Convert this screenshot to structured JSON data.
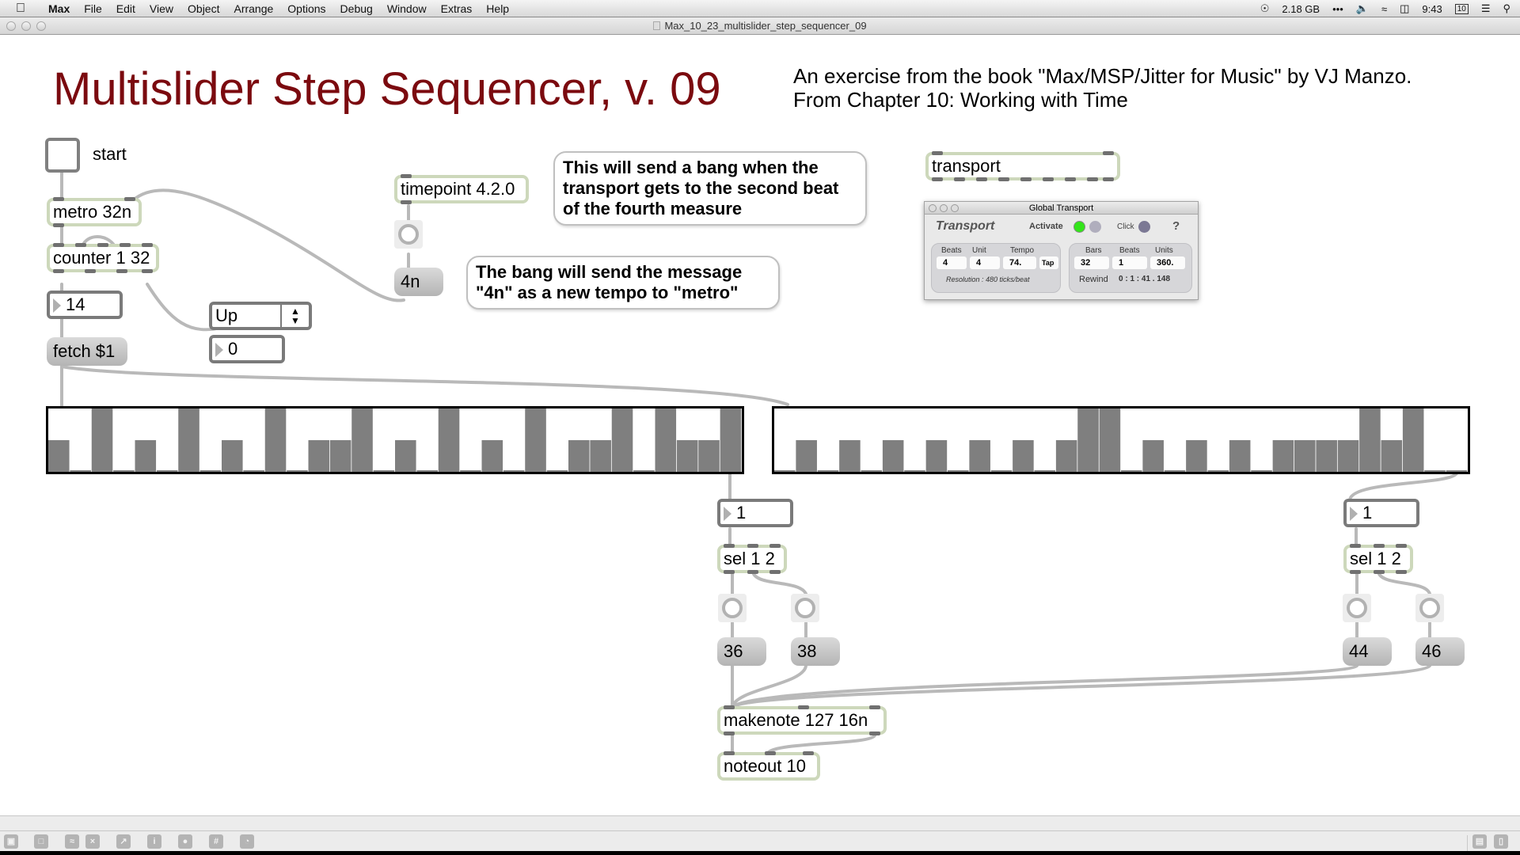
{
  "menubar": {
    "apple": "",
    "app": "Max",
    "items": [
      "File",
      "Edit",
      "View",
      "Object",
      "Arrange",
      "Options",
      "Debug",
      "Window",
      "Extras",
      "Help"
    ],
    "status": {
      "memory": "2.18 GB",
      "dots": "•••",
      "time": "9:43",
      "calendar": "10"
    }
  },
  "window": {
    "title": "Max_10_23_multislider_step_sequencer_09"
  },
  "patch": {
    "title": "Multislider Step Sequencer, v. 09",
    "subtitle_line1": "An exercise from the book \"Max/MSP/Jitter for Music\" by VJ Manzo.",
    "subtitle_line2": "From Chapter 10: Working with Time",
    "start_label": "start",
    "metro": "metro 32n",
    "counter": "counter 1 32",
    "counter_value": "14",
    "umenu_value": "Up",
    "direction_value": "0",
    "fetch": "fetch $1",
    "timepoint": "timepoint 4.2.0",
    "tempo_msg": "4n",
    "comment_timepoint": [
      "This will send a bang when the",
      "transport gets to the second beat",
      "of the fourth measure"
    ],
    "comment_msg": [
      "The bang will send the message",
      "\"4n\" as a new tempo to \"metro\""
    ],
    "transport": "transport",
    "left_number": "1",
    "right_number": "1",
    "left_sel": "sel 1 2",
    "right_sel": "sel 1 2",
    "note_36": "36",
    "note_38": "38",
    "note_44": "44",
    "note_46": "46",
    "makenote": "makenote 127 16n",
    "noteout": "noteout 10"
  },
  "multisliders": {
    "range": [
      0,
      2
    ],
    "left": [
      1,
      0,
      2,
      0,
      1,
      0,
      2,
      0,
      1,
      0,
      2,
      0,
      1,
      1,
      2,
      0,
      1,
      0,
      2,
      0,
      1,
      0,
      2,
      0,
      1,
      1,
      2,
      0,
      2,
      1,
      1,
      2
    ],
    "right": [
      0,
      1,
      0,
      1,
      0,
      1,
      0,
      1,
      0,
      1,
      0,
      1,
      0,
      1,
      2,
      2,
      0,
      1,
      0,
      1,
      0,
      1,
      0,
      1,
      1,
      1,
      1,
      2,
      1,
      2,
      0,
      0
    ]
  },
  "global_transport": {
    "window_title": "Global Transport",
    "heading": "Transport",
    "activate_label": "Activate",
    "click_label": "Click",
    "help": "?",
    "activate_color": "#33e51a",
    "labels": {
      "beats": "Beats",
      "unit": "Unit",
      "tempo": "Tempo",
      "bars": "Bars",
      "beats2": "Beats",
      "units": "Units"
    },
    "beats": "4",
    "unit": "4",
    "tempo": "74.",
    "tap": "Tap",
    "bars": "32",
    "beats_pos": "1",
    "units_pos": "360.",
    "resolution": "Resolution : 480 ticks/beat",
    "rewind": "Rewind",
    "time": "0 : 1 : 41 . 148"
  },
  "palette": {
    "icons": [
      "lock-icon",
      "new-object-icon",
      "patch-cords-icon",
      "clear-icon",
      "presentation-icon",
      "inspector-icon",
      "connect-icon",
      "grid-icon",
      "snap-icon"
    ],
    "right_icons": [
      "split-horizontal-icon",
      "split-vertical-icon"
    ]
  }
}
